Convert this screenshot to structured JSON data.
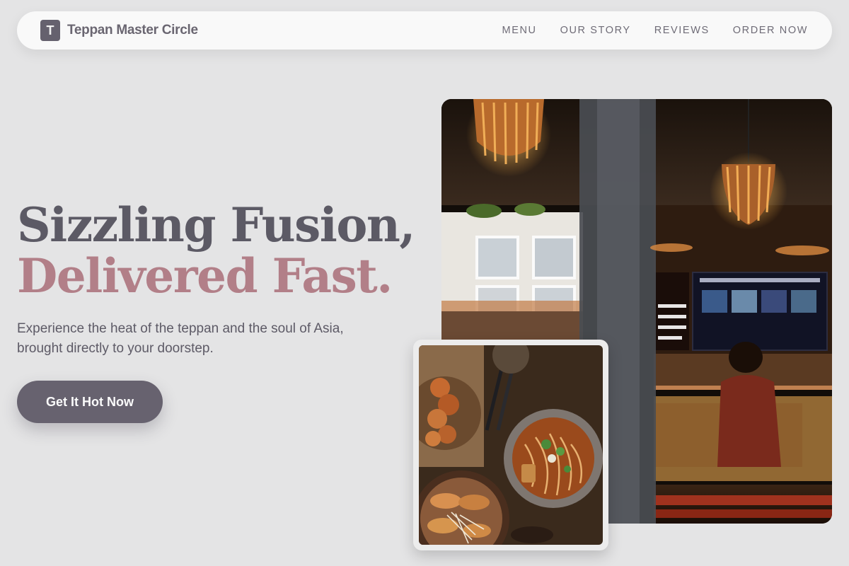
{
  "brand": {
    "mark": "T",
    "name": "Teppan Master Circle"
  },
  "nav": {
    "links": [
      {
        "label": "MENU"
      },
      {
        "label": "OUR STORY"
      },
      {
        "label": "REVIEWS"
      },
      {
        "label": "ORDER NOW"
      }
    ]
  },
  "hero": {
    "headline_line1": "Sizzling Fusion,",
    "headline_line2": "Delivered Fast.",
    "subtitle": "Experience the heat of the teppan and the soul of Asia, brought directly to your doorstep.",
    "cta_label": "Get It Hot Now"
  },
  "images": {
    "main": {
      "subject": "restaurant interior with pendant lamps and menu board"
    },
    "food": {
      "subject": "overhead view of ramen, fried chicken and gyoza"
    }
  },
  "colors": {
    "background": "#e4e4e5",
    "accent_dark": "#67626f",
    "accent_rose": "#b27f88"
  }
}
